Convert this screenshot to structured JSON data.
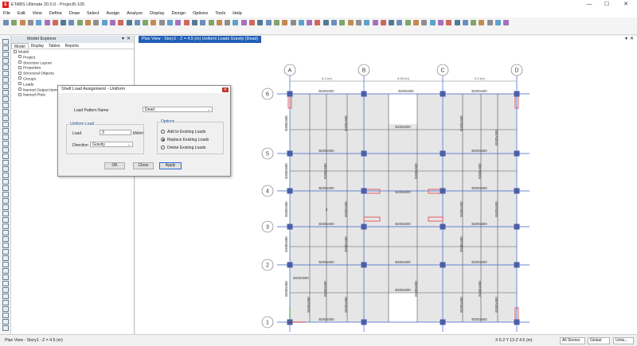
{
  "window": {
    "title": "ETABS Ultimate 20.0.0 - Project5-105",
    "controls": [
      "—",
      "☐",
      "✕"
    ]
  },
  "menu": [
    "File",
    "Edit",
    "View",
    "Define",
    "Draw",
    "Select",
    "Assign",
    "Analyze",
    "Display",
    "Design",
    "Options",
    "Tools",
    "Help"
  ],
  "explorer": {
    "title": "Model Explorer",
    "tabs": [
      "Model",
      "Display",
      "Tables",
      "Reports"
    ],
    "tree": [
      "Model",
      "Project",
      "Structure Layout",
      "Properties",
      "Structural Objects",
      "Groups",
      "Loads",
      "Named Output Items",
      "Named Plots"
    ]
  },
  "dialog": {
    "title": "Shell Load Assignment - Uniform",
    "close": "✕",
    "load_pattern_label": "Load Pattern Name",
    "load_pattern_value": "Dead",
    "uniform_group": "Uniform Load",
    "load_label": "Load",
    "load_value": "3",
    "load_unit": "kN/m²",
    "direction_label": "Direction",
    "direction_value": "Gravity",
    "options_group": "Options",
    "options": [
      "Add to Existing Loads",
      "Replace Existing Loads",
      "Delete Existing Loads"
    ],
    "selected_option": 1,
    "buttons": {
      "ok": "OK",
      "close": "Close",
      "apply": "Apply"
    }
  },
  "view": {
    "tab_title": "Plan View - Story1 - Z = 4.5 (m)  Uniform Loads Gravity  (Dead)",
    "grid_letters": [
      "A",
      "B",
      "C",
      "D"
    ],
    "grid_numbers": [
      "6",
      "5",
      "4",
      "3",
      "2",
      "1"
    ],
    "spacing_labels": [
      "5.4 (m)",
      "6.55 (m)",
      "5.4 (m)"
    ],
    "beam_label": "B300x500",
    "slab_label": "3"
  },
  "status": {
    "view_label": "Plan View - Story1 - Z = 4.5 (m)",
    "coords": "X 6.2  Y 13  Z 4.5 (m)",
    "stories": "All Stories",
    "global": "Global",
    "units": "Units..."
  },
  "colors": {
    "accent": "#1f5fb8",
    "grid_line": "#3a5fcd",
    "column": "#4a5fa8",
    "slab_fill": "#e6e6e6",
    "wall": "#e05050"
  }
}
